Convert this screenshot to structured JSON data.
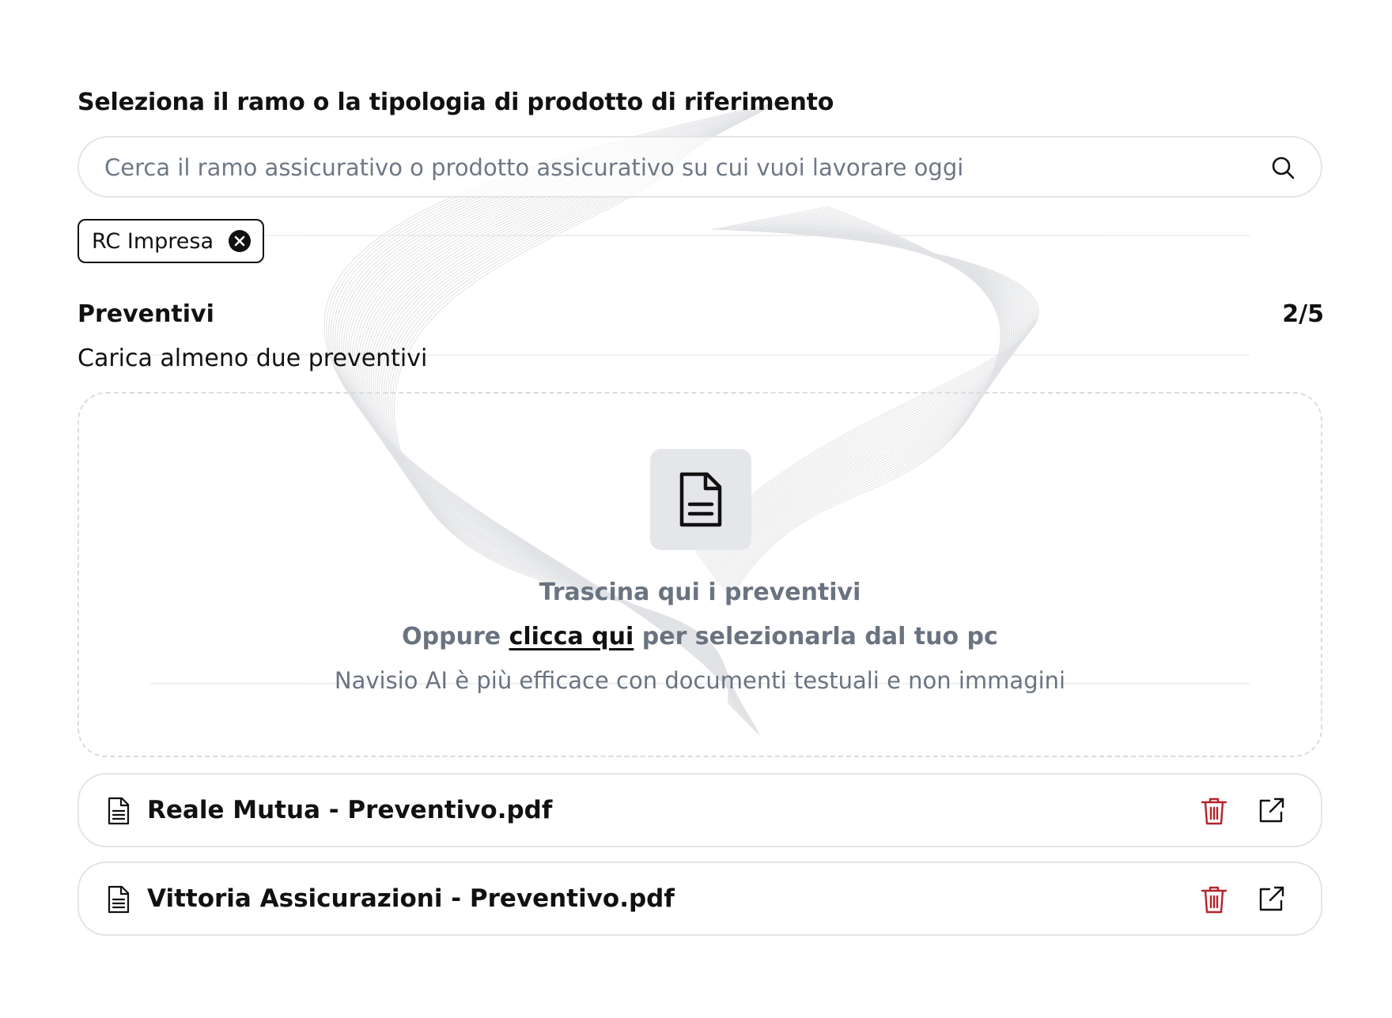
{
  "search": {
    "title": "Seleziona il ramo o la tipologia di prodotto di riferimento",
    "placeholder": "Cerca il ramo assicurativo o prodotto assicurativo su cui vuoi lavorare oggi",
    "value": ""
  },
  "selected_tags": [
    {
      "label": "RC Impresa"
    }
  ],
  "preventivi": {
    "title": "Preventivi",
    "count": "2/5",
    "subtitle": "Carica almeno due preventivi"
  },
  "dropzone": {
    "line1": "Trascina qui i preventivi",
    "line2_prefix": "Oppure ",
    "line2_link": "clicca qui",
    "line2_suffix": " per selezionarla dal tuo pc",
    "hint": "Navisio AI è più efficace con documenti testuali e non immagini"
  },
  "files": [
    {
      "name": "Reale Mutua - Preventivo.pdf"
    },
    {
      "name": "Vittoria Assicurazioni - Preventivo.pdf"
    }
  ],
  "colors": {
    "text": "#111111",
    "muted": "#6a7380",
    "border": "#e3e5e8",
    "icon_box": "#e5e6e9",
    "delete": "#b4232a"
  },
  "icons": {
    "search": "search-icon",
    "chip_remove": "close-circle-icon",
    "dropzone": "document-icon",
    "file": "document-icon",
    "delete": "trash-icon",
    "open": "external-link-icon"
  }
}
